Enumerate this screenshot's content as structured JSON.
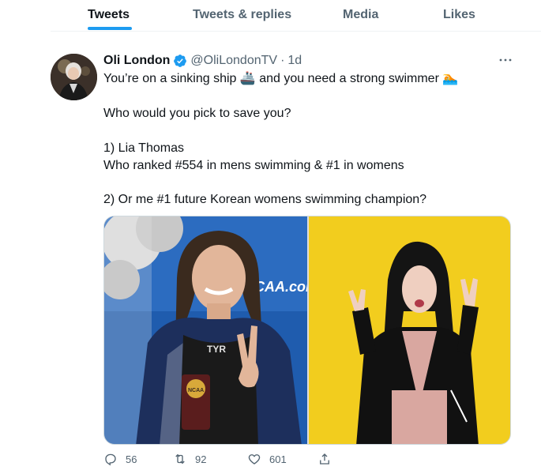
{
  "tabs": [
    {
      "label": "Tweets",
      "active": true
    },
    {
      "label": "Tweets & replies",
      "active": false
    },
    {
      "label": "Media",
      "active": false
    },
    {
      "label": "Likes",
      "active": false
    }
  ],
  "tweet": {
    "author_name": "Oli London",
    "handle": "@OliLondonTV",
    "separator": "·",
    "time": "1d",
    "lines": [
      "You’re on a sinking ship 🚢 and you need a strong swimmer 🏊",
      "Who would you pick to save you?",
      "1) Lia Thomas",
      "Who ranked #554 in mens swimming & #1 in womens",
      "2) Or me #1 future Korean womens swimming champion?"
    ],
    "media_left_sign": "CAA.com",
    "media_left_cap_logo": "TYR",
    "media_left_trophy": "NCAA",
    "stats": {
      "replies": "56",
      "retweets": "92",
      "likes": "601"
    }
  },
  "colors": {
    "accent": "#1d9bf0",
    "muted": "#536471",
    "text": "#0f1419",
    "yellow_bg": "#f2cd1e",
    "pool_blue": "#1e5bb0"
  },
  "icons": {
    "verified": "verified-badge-icon",
    "more": "more-dots-icon",
    "reply": "reply-icon",
    "retweet": "retweet-icon",
    "like": "heart-icon",
    "share": "share-icon"
  }
}
